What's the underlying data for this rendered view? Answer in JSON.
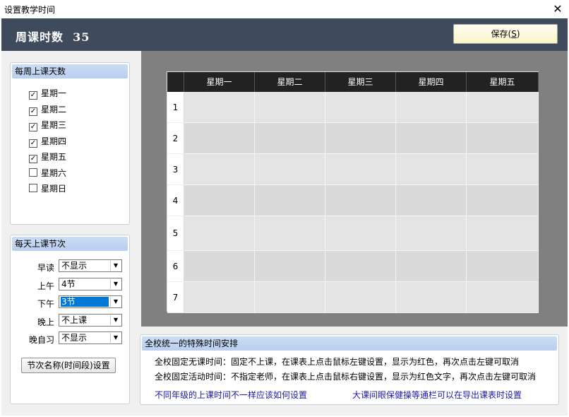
{
  "window": {
    "title": "设置教学时间",
    "close_icon": "✕"
  },
  "header": {
    "weekly_hours_label": "周课时数",
    "weekly_hours": "35",
    "save_label": "保存(S)"
  },
  "days_panel": {
    "title": "每周上课天数",
    "days": [
      {
        "label": "星期一",
        "checked": true
      },
      {
        "label": "星期二",
        "checked": true
      },
      {
        "label": "星期三",
        "checked": true
      },
      {
        "label": "星期四",
        "checked": true
      },
      {
        "label": "星期五",
        "checked": true
      },
      {
        "label": "星期六",
        "checked": false
      },
      {
        "label": "星期日",
        "checked": false
      }
    ]
  },
  "periods_panel": {
    "title": "每天上课节次",
    "rows": [
      {
        "label": "早读",
        "value": "不显示"
      },
      {
        "label": "上午",
        "value": "4节"
      },
      {
        "label": "下午",
        "value": "3节"
      },
      {
        "label": "晚上",
        "value": "不上课"
      },
      {
        "label": "晚自习",
        "value": "不显示"
      }
    ],
    "period_name_button": "节次名称(时间段)设置"
  },
  "timetable": {
    "columns": [
      "星期一",
      "星期二",
      "星期三",
      "星期四",
      "星期五"
    ],
    "rows": [
      "1",
      "2",
      "3",
      "4",
      "5",
      "6",
      "7"
    ]
  },
  "special_panel": {
    "title": "全校统一的特殊时间安排",
    "line1": "全校固定无课时间：固定不上课，在课表上点击鼠标左键设置，显示为红色，再次点击左键可取消",
    "line2": "全校固定活动时间：不指定老师，在课表上点击鼠标右键设置，显示为红色文字，再次点击左键可取消",
    "link1": "不同年级的上课时间不一样应该如何设置",
    "link2": "大课间眼保健操等通栏可以在导出课表时设置"
  },
  "colors": {
    "header_bg": "#3f4a5d",
    "grid_bg": "#808080",
    "row_even": "#e4e4e4",
    "row_odd": "#dadada",
    "selected": "#0078d7"
  }
}
